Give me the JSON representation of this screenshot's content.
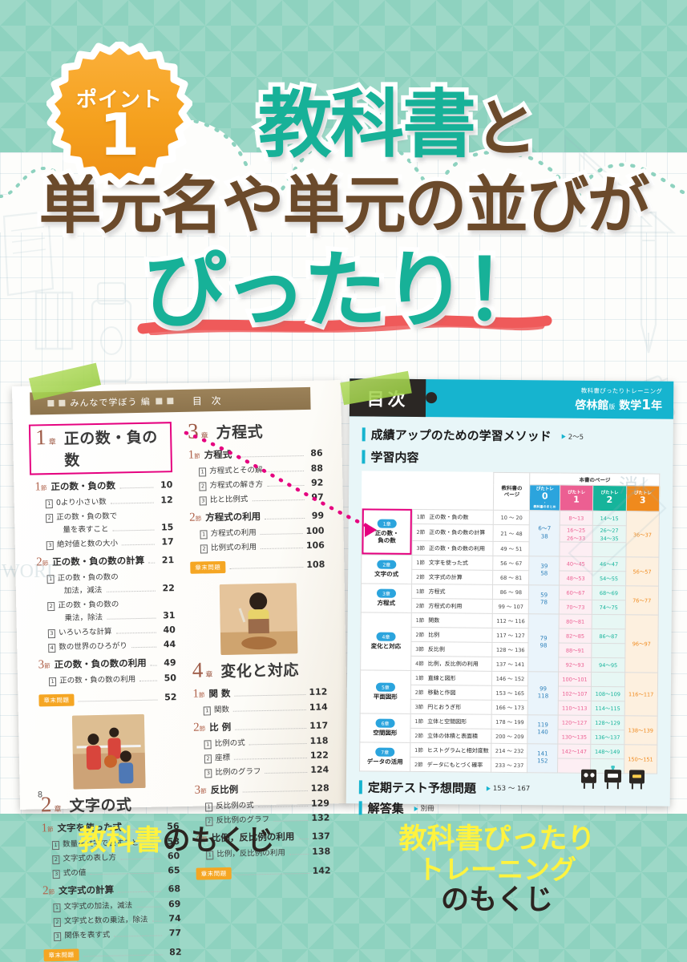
{
  "badge": {
    "label": "ポイント",
    "number": "1"
  },
  "headline": {
    "line1_teal": "教科書",
    "line1_brown": "と",
    "line2": "単元名や単元の並びが",
    "line3": "ぴったり！"
  },
  "left_page": {
    "header": {
      "mark": "■",
      "text": "みんなで学ぼう 編",
      "title": "目 次"
    },
    "page_number": "8",
    "columns": [
      {
        "chapters": [
          {
            "num": "1",
            "unit": "章",
            "name": "正の数・負の数",
            "highlighted": true,
            "sections": [
              {
                "n": "1",
                "u": "節",
                "title": "正の数・負の数",
                "page": "10",
                "subs": [
                  {
                    "n": "1",
                    "title": "0より小さい数",
                    "page": "12"
                  },
                  {
                    "n": "2",
                    "title": "正の数・負の数で",
                    "title2": "量を表すこと",
                    "page": "15"
                  },
                  {
                    "n": "3",
                    "title": "絶対値と数の大小",
                    "page": "17"
                  }
                ]
              },
              {
                "n": "2",
                "u": "節",
                "title": "正の数・負の数の計算",
                "page": "21",
                "subs": [
                  {
                    "n": "1",
                    "title": "正の数・負の数の",
                    "title2": "加法，減法",
                    "page": "22"
                  },
                  {
                    "n": "2",
                    "title": "正の数・負の数の",
                    "title2": "乗法，除法",
                    "page": "31"
                  },
                  {
                    "n": "3",
                    "title": "いろいろな計算",
                    "page": "40"
                  },
                  {
                    "n": "4",
                    "title": "数の世界のひろがり",
                    "page": "44"
                  }
                ]
              },
              {
                "n": "3",
                "u": "節",
                "title": "正の数・負の数の利用",
                "page": "49",
                "subs": [
                  {
                    "n": "1",
                    "title": "正の数・負の数の利用",
                    "page": "50"
                  }
                ]
              }
            ],
            "tail": {
              "badge": "章末問題",
              "page": "52"
            },
            "photo": "basketball-photo"
          },
          {
            "num": "2",
            "unit": "章",
            "name": "文字の式",
            "highlighted": false,
            "sections": [
              {
                "n": "1",
                "u": "節",
                "title": "文字を使った式",
                "page": "56",
                "subs": [
                  {
                    "n": "1",
                    "title": "数量を文字で表すこと",
                    "page": "58"
                  },
                  {
                    "n": "2",
                    "title": "文字式の表し方",
                    "page": "60"
                  },
                  {
                    "n": "3",
                    "title": "式の値",
                    "page": "65"
                  }
                ]
              },
              {
                "n": "2",
                "u": "節",
                "title": "文字式の計算",
                "page": "68",
                "subs": [
                  {
                    "n": "1",
                    "title": "文字式の加法，減法",
                    "page": "69"
                  },
                  {
                    "n": "2",
                    "title": "文字式と数の乗法，除法",
                    "page": "74"
                  },
                  {
                    "n": "3",
                    "title": "関係を表す式",
                    "page": "77"
                  }
                ]
              }
            ],
            "tail": {
              "badge": "章末問題",
              "page": "82"
            }
          }
        ]
      },
      {
        "chapters": [
          {
            "num": "3",
            "unit": "章",
            "name": "方程式",
            "highlighted": false,
            "sections": [
              {
                "n": "1",
                "u": "節",
                "title": "方程式",
                "page": "86",
                "subs": [
                  {
                    "n": "1",
                    "title": "方程式とその解",
                    "page": "88"
                  },
                  {
                    "n": "2",
                    "title": "方程式の解き方",
                    "page": "92"
                  },
                  {
                    "n": "3",
                    "title": "比と比例式",
                    "page": "97"
                  }
                ]
              },
              {
                "n": "2",
                "u": "節",
                "title": "方程式の利用",
                "page": "99",
                "subs": [
                  {
                    "n": "1",
                    "title": "方程式の利用",
                    "page": "100"
                  },
                  {
                    "n": "2",
                    "title": "比例式の利用",
                    "page": "106"
                  }
                ]
              }
            ],
            "tail": {
              "badge": "章末問題",
              "page": "108"
            },
            "photo": "cooking-photo"
          },
          {
            "num": "4",
            "unit": "章",
            "name": "変化と対応",
            "highlighted": false,
            "sections": [
              {
                "n": "1",
                "u": "節",
                "title": "関 数",
                "page": "112",
                "subs": [
                  {
                    "n": "1",
                    "title": "関数",
                    "page": "114"
                  }
                ]
              },
              {
                "n": "2",
                "u": "節",
                "title": "比 例",
                "page": "117",
                "subs": [
                  {
                    "n": "1",
                    "title": "比例の式",
                    "page": "118"
                  },
                  {
                    "n": "2",
                    "title": "座標",
                    "page": "122"
                  },
                  {
                    "n": "3",
                    "title": "比例のグラフ",
                    "page": "124"
                  }
                ]
              },
              {
                "n": "3",
                "u": "節",
                "title": "反比例",
                "page": "128",
                "subs": [
                  {
                    "n": "1",
                    "title": "反比例の式",
                    "page": "129"
                  },
                  {
                    "n": "2",
                    "title": "反比例のグラフ",
                    "page": "132"
                  }
                ]
              },
              {
                "n": "4",
                "u": "節",
                "title": "比例，反比例の利用",
                "page": "137",
                "subs": [
                  {
                    "n": "1",
                    "title": "比例，反比例の利用",
                    "page": "138"
                  }
                ]
              }
            ],
            "tail": {
              "badge": "章末問題",
              "page": "142"
            }
          }
        ]
      }
    ]
  },
  "right_page": {
    "tab_title": "目次",
    "brand_line1": "教科書ぴったりトレーニング",
    "brand_line2": "啓林館",
    "brand_line2_small": "版",
    "brand_line3": "数学",
    "brand_grade": "1",
    "brand_year": "年",
    "method_heading": "成績アップのための学習メソッド",
    "method_pages": "2〜5",
    "content_heading": "学習内容",
    "table": {
      "span_header": "本書のページ",
      "col_textbook": "教科書の\nページ",
      "col_textbook_l1": "教科書の",
      "col_textbook_l2": "ページ",
      "cols": [
        {
          "label": "ぴたトレ",
          "num": "0",
          "sub": "・\n教科書のまとめ",
          "sub_dot": "・",
          "sub_txt": "教科書のまとめ",
          "color": "#2ba4dd"
        },
        {
          "label": "ぴたトレ",
          "num": "1",
          "sub": "",
          "color": "#ec5f92"
        },
        {
          "label": "ぴたトレ",
          "num": "2",
          "sub": "",
          "color": "#16b49b"
        },
        {
          "label": "ぴたトレ",
          "num": "3",
          "sub": "",
          "color": "#f08a1d"
        }
      ],
      "chapters": [
        {
          "pill": "1章",
          "name_l1": "正の数・",
          "name_l2": "負の数",
          "highlighted": true,
          "rows": [
            {
              "sec": "1節",
              "title": "正の数・負の数",
              "tpage": "10 〜 20",
              "p0": "",
              "p1": "8〜13",
              "p2": "14〜15",
              "p3": ""
            },
            {
              "sec": "2節",
              "title": "正の数・負の数の計算",
              "tpage": "21 〜 48",
              "p0": "6〜7\n38",
              "p1": "16〜25\n26〜33",
              "p2": "26〜27\n34〜35",
              "p3": "36〜37"
            },
            {
              "sec": "3節",
              "title": "正の数・負の数の利用",
              "tpage": "49 〜 51",
              "p0": "",
              "p1": "",
              "p2": "",
              "p3": ""
            }
          ],
          "p0_merged": "6〜7\n38",
          "p3_merged": "36〜37"
        },
        {
          "pill": "2章",
          "name_l1": "文字の式",
          "name_l2": "",
          "highlighted": false,
          "rows": [
            {
              "sec": "1節",
              "title": "文字を使った式",
              "tpage": "56 〜 67",
              "p1": "40〜45",
              "p2": "46〜47"
            },
            {
              "sec": "2節",
              "title": "文字式の計算",
              "tpage": "68 〜 81",
              "p1": "48〜53",
              "p2": "54〜55"
            }
          ],
          "p0_merged": "39\n58",
          "p3_merged": "56〜57"
        },
        {
          "pill": "3章",
          "name_l1": "方程式",
          "name_l2": "",
          "highlighted": false,
          "rows": [
            {
              "sec": "1節",
              "title": "方程式",
              "tpage": "86 〜 98",
              "p1": "60〜67",
              "p2": "68〜69"
            },
            {
              "sec": "2節",
              "title": "方程式の利用",
              "tpage": "99 〜 107",
              "p1": "70〜73",
              "p2": "74〜75"
            }
          ],
          "p0_merged": "59\n78",
          "p3_merged": "76〜77"
        },
        {
          "pill": "4章",
          "name_l1": "変化と対応",
          "name_l2": "",
          "highlighted": false,
          "rows": [
            {
              "sec": "1節",
              "title": "関数",
              "tpage": "112 〜 116",
              "p1": "80〜81",
              "p2": ""
            },
            {
              "sec": "2節",
              "title": "比例",
              "tpage": "117 〜 127",
              "p1": "82〜85",
              "p2": "86〜87"
            },
            {
              "sec": "3節",
              "title": "反比例",
              "tpage": "128 〜 136",
              "p1": "88〜91",
              "p2": ""
            },
            {
              "sec": "4節",
              "title": "比例，反比例の利用",
              "tpage": "137 〜 141",
              "p1": "92〜93",
              "p2": "94〜95"
            }
          ],
          "p0_merged": "79\n98",
          "p3_merged": "96〜97"
        },
        {
          "pill": "5章",
          "name_l1": "平面図形",
          "name_l2": "",
          "highlighted": false,
          "rows": [
            {
              "sec": "1節",
              "title": "直線と図形",
              "tpage": "146 〜 152",
              "p1": "100〜101",
              "p2": ""
            },
            {
              "sec": "2節",
              "title": "移動と作図",
              "tpage": "153 〜 165",
              "p1": "102〜107",
              "p2": "108〜109"
            },
            {
              "sec": "3節",
              "title": "円とおうぎ形",
              "tpage": "166 〜 173",
              "p1": "110〜113",
              "p2": "114〜115"
            }
          ],
          "p0_merged": "99\n118",
          "p3_merged": "116〜117"
        },
        {
          "pill": "6章",
          "name_l1": "空間図形",
          "name_l2": "",
          "highlighted": false,
          "rows": [
            {
              "sec": "1節",
              "title": "立体と空間図形",
              "tpage": "178 〜 199",
              "p1": "120〜127",
              "p2": "128〜129"
            },
            {
              "sec": "2節",
              "title": "立体の体積と表面積",
              "tpage": "200 〜 209",
              "p1": "130〜135",
              "p2": "136〜137"
            }
          ],
          "p0_merged": "119\n140",
          "p3_merged": "138〜139"
        },
        {
          "pill": "7章",
          "name_l1": "データの活用",
          "name_l2": "",
          "highlighted": false,
          "rows": [
            {
              "sec": "1節",
              "title": "ヒストグラムと相対度数",
              "tpage": "214 〜 232",
              "p1": "142〜147",
              "p2": "148〜149"
            },
            {
              "sec": "2節",
              "title": "データにもとづく確率",
              "tpage": "233 〜 237",
              "p1": "",
              "p2": ""
            }
          ],
          "p0_merged": "141\n152",
          "p3_merged": "150〜151"
        }
      ]
    },
    "footer": [
      {
        "title": "定期テスト予想問題",
        "pages": "153 〜 167"
      },
      {
        "title": "解答集",
        "pages": "別冊"
      }
    ]
  },
  "captions": {
    "left_yellow": "教科書",
    "left_black": "のもくじ",
    "right_yellow_l1": "教科書ぴったり",
    "right_yellow_l2": "トレーニング",
    "right_black": "のもくじ"
  },
  "colors": {
    "teal": "#17b198",
    "brown": "#6b4a2b",
    "orange": "#f5a623",
    "magenta": "#e5007f",
    "cyan": "#16b4cf",
    "yellow": "#fff33f",
    "bg_green": "#8ed2bf"
  }
}
